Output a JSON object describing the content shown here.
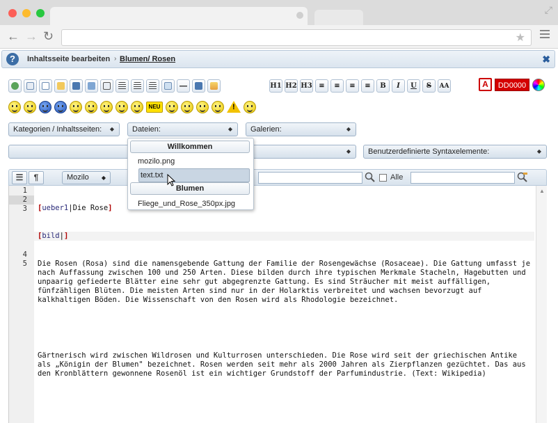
{
  "header": {
    "title": "Inhaltsseite bearbeiten",
    "separator": "›",
    "breadcrumb": "Blumen/ Rosen"
  },
  "toolbar": {
    "format_buttons": [
      "H1",
      "H2",
      "H3",
      "≡",
      "≡",
      "≡",
      "≡",
      "B",
      "I",
      "U",
      "S",
      "AA"
    ],
    "color_value": "DD0000",
    "color_letter": "A",
    "icon_names": [
      "link-icon",
      "mail-icon",
      "page-icon",
      "folder-icon",
      "save-icon",
      "image-icon",
      "table-icon",
      "align-icon",
      "list-icon",
      "numbered-list-icon",
      "grid-icon",
      "line-icon",
      "html-icon",
      "picture-icon"
    ]
  },
  "selects": {
    "categories": "Kategorien / Inhaltsseiten:",
    "files": "Dateien:",
    "galleries": "Galerien:",
    "custom_syntax": "Benutzerdefinierte Syntaxelemente:"
  },
  "editbar": {
    "mode": "Mozilo",
    "alle_label": "Alle"
  },
  "dropdown": {
    "group1": "Willkommen",
    "group1_items": [
      "mozilo.png",
      "text.txt"
    ],
    "group2": "Blumen",
    "group2_items": [
      "Fliege_und_Rose_350px.jpg"
    ],
    "highlighted": "text.txt"
  },
  "editor": {
    "line_numbers": [
      "1",
      "2",
      "3",
      "",
      "",
      "",
      "",
      "4",
      "5"
    ],
    "lines": [
      {
        "open": "[",
        "tag": "ueber1",
        "sep": "|",
        "text": "Die Rose",
        "close": "]"
      },
      {
        "open": "[",
        "tag": "bild",
        "sep": "|",
        "text": "",
        "close": "]"
      }
    ],
    "paragraph1": "Die Rosen (Rosa) sind die namensgebende Gattung der Familie der Rosengewächse (Rosaceae). Die Gattung umfasst je nach Auffassung zwischen 100 und 250 Arten. Diese bilden durch ihre typischen Merkmale Stacheln, Hagebutten und unpaarig gefiederte Blätter eine sehr gut abgegrenzte Gattung. Es sind Sträucher mit meist auffälligen, fünfzähligen Blüten. Die meisten Arten sind nur in der Holarktis verbreitet und wachsen bevorzugt auf kalkhaltigen Böden. Die Wissenschaft von den Rosen wird als Rhodologie bezeichnet.",
    "paragraph2": "Gärtnerisch wird zwischen Wildrosen und Kulturrosen unterschieden. Die Rose wird seit der griechischen Antike als „Königin der Blumen\" bezeichnet. Rosen werden seit mehr als 2000 Jahren als Zierpflanzen gezüchtet. Das aus den Kronblättern gewonnene Rosenöl ist ein wichtiger Grundstoff der Parfumindustrie. (Text: Wikipedia)"
  },
  "colors": {
    "accent": "#3c6ea6",
    "text_color_swatch": "#d40000"
  }
}
